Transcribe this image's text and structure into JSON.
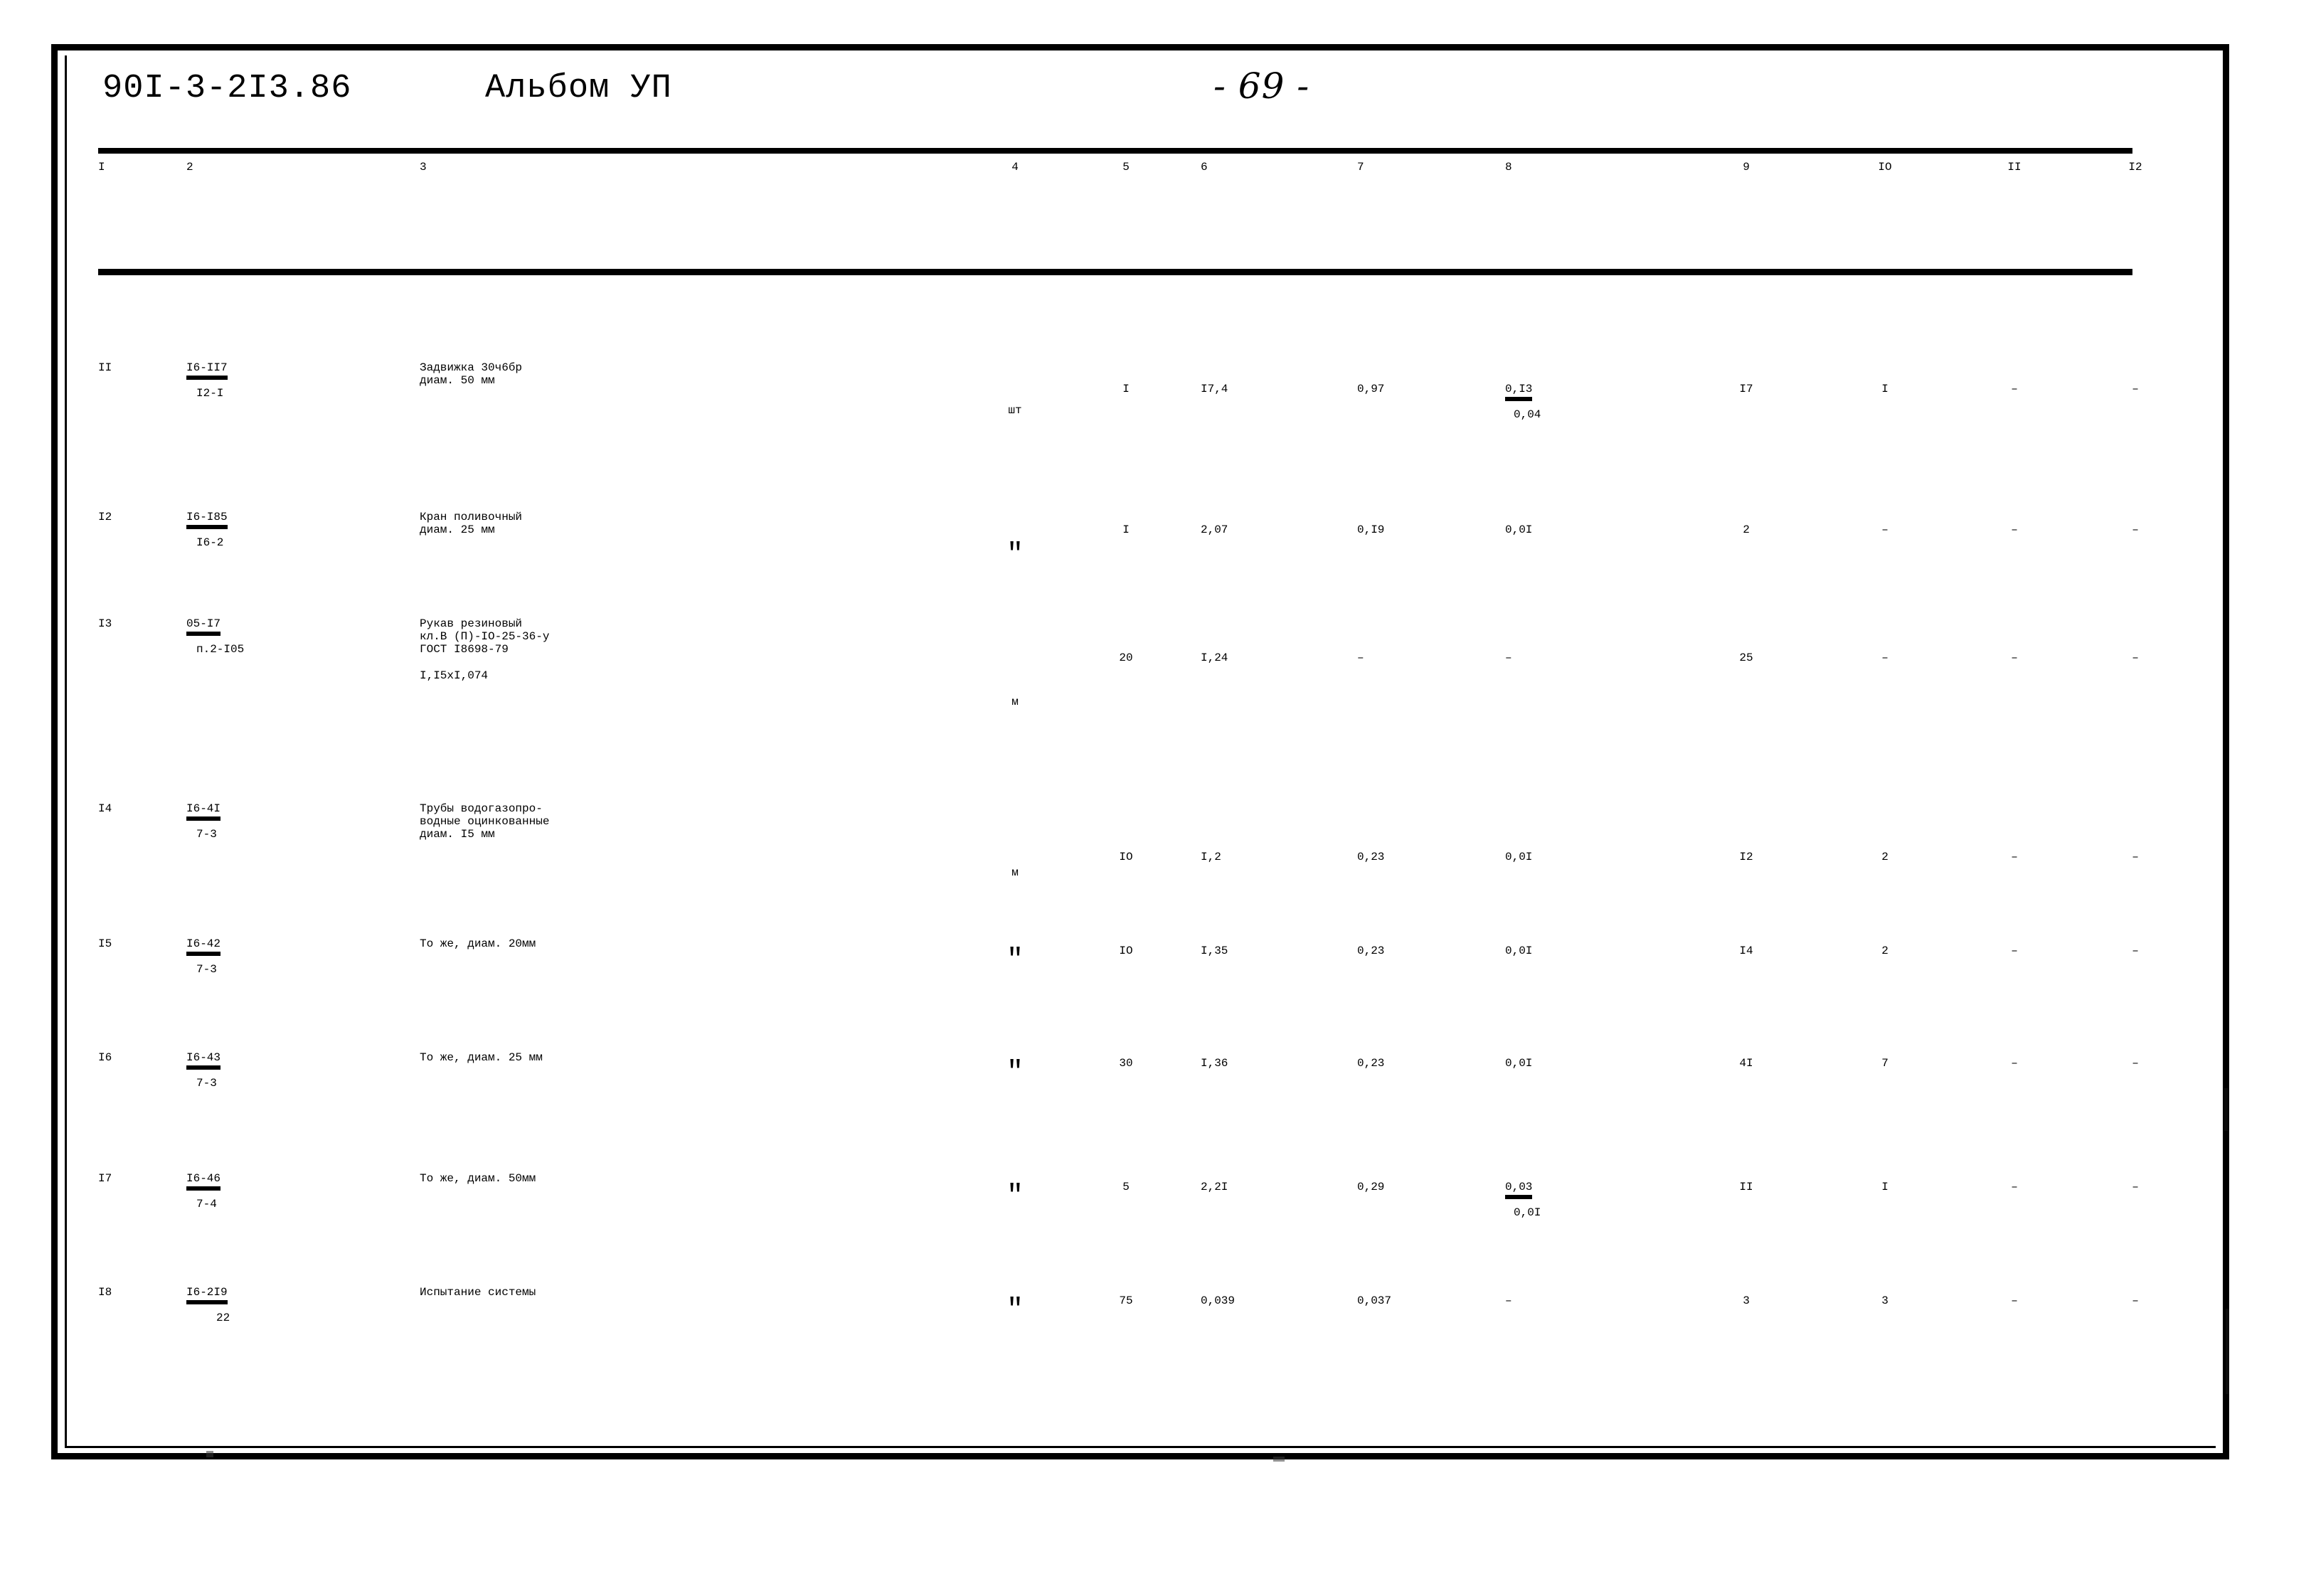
{
  "header": {
    "doc_code": "90I-3-2I3.86",
    "album": "Альбом УП",
    "page_label": "- 69 -"
  },
  "table": {
    "column_headers": [
      "I",
      "2",
      "3",
      "4",
      "5",
      "6",
      "7",
      "8",
      "9",
      "IO",
      "II",
      "I2"
    ],
    "rows": [
      {
        "num": "II",
        "code_top": "I6-II7",
        "code_bottom": "I2-I",
        "desc": [
          "Задвижка 30ч6бр",
          "диам. 50 мм"
        ],
        "unit": "шт",
        "c5": "I",
        "c6": "I7,4",
        "c7": "0,97",
        "c8_top": "0,I3",
        "c8_bottom": "0,04",
        "c9": "I7",
        "c10": "I",
        "c11": "–",
        "c12": "–"
      },
      {
        "num": "I2",
        "code_top": "I6-I85",
        "code_bottom": "I6-2",
        "desc": [
          "Кран поливочный",
          "диам. 25 мм"
        ],
        "unit": "\"",
        "c5": "I",
        "c6": "2,07",
        "c7": "0,I9",
        "c8_top": "0,0I",
        "c8_bottom": "",
        "c9": "2",
        "c10": "–",
        "c11": "–",
        "c12": "–"
      },
      {
        "num": "I3",
        "code_top": "05-I7",
        "code_bottom": "п.2-I05",
        "desc": [
          "Рукав резиновый",
          "кл.В (П)-IO-25-36-у",
          "ГОСТ I8698-79",
          "",
          "I,I5xI,074"
        ],
        "unit": "м",
        "c5": "20",
        "c6": "I,24",
        "c7": "–",
        "c8_top": "–",
        "c8_bottom": "",
        "c9": "25",
        "c10": "–",
        "c11": "–",
        "c12": "–"
      },
      {
        "num": "I4",
        "code_top": "I6-4I",
        "code_bottom": "7-3",
        "desc": [
          "Трубы водогазопро-",
          "водные оцинкованные",
          "диам. I5 мм"
        ],
        "unit": "м",
        "c5": "IO",
        "c6": "I,2",
        "c7": "0,23",
        "c8_top": "0,0I",
        "c8_bottom": "",
        "c9": "I2",
        "c10": "2",
        "c11": "–",
        "c12": "–"
      },
      {
        "num": "I5",
        "code_top": "I6-42",
        "code_bottom": "7-3",
        "desc": [
          "То же, диам. 20мм"
        ],
        "unit": "\"",
        "c5": "IO",
        "c6": "I,35",
        "c7": "0,23",
        "c8_top": "0,0I",
        "c8_bottom": "",
        "c9": "I4",
        "c10": "2",
        "c11": "–",
        "c12": "–"
      },
      {
        "num": "I6",
        "code_top": "I6-43",
        "code_bottom": "7-3",
        "desc": [
          "То же, диам. 25 мм"
        ],
        "unit": "\"",
        "c5": "30",
        "c6": "I,36",
        "c7": "0,23",
        "c8_top": "0,0I",
        "c8_bottom": "",
        "c9": "4I",
        "c10": "7",
        "c11": "–",
        "c12": "–"
      },
      {
        "num": "I7",
        "code_top": "I6-46",
        "code_bottom": "7-4",
        "desc": [
          "То же, диам. 50мм"
        ],
        "unit": "\"",
        "c5": "5",
        "c6": "2,2I",
        "c7": "0,29",
        "c8_top": "0,03",
        "c8_bottom": "0,0I",
        "c9": "II",
        "c10": "I",
        "c11": "–",
        "c12": "–"
      },
      {
        "num": "I8",
        "code_top": "I6-2I9",
        "code_bottom": "22",
        "desc": [
          "Испытание системы"
        ],
        "unit": "\"",
        "c5": "75",
        "c6": "0,039",
        "c7": "0,037",
        "c8_top": "–",
        "c8_bottom": "",
        "c9": "3",
        "c10": "3",
        "c11": "–",
        "c12": "–"
      }
    ]
  }
}
